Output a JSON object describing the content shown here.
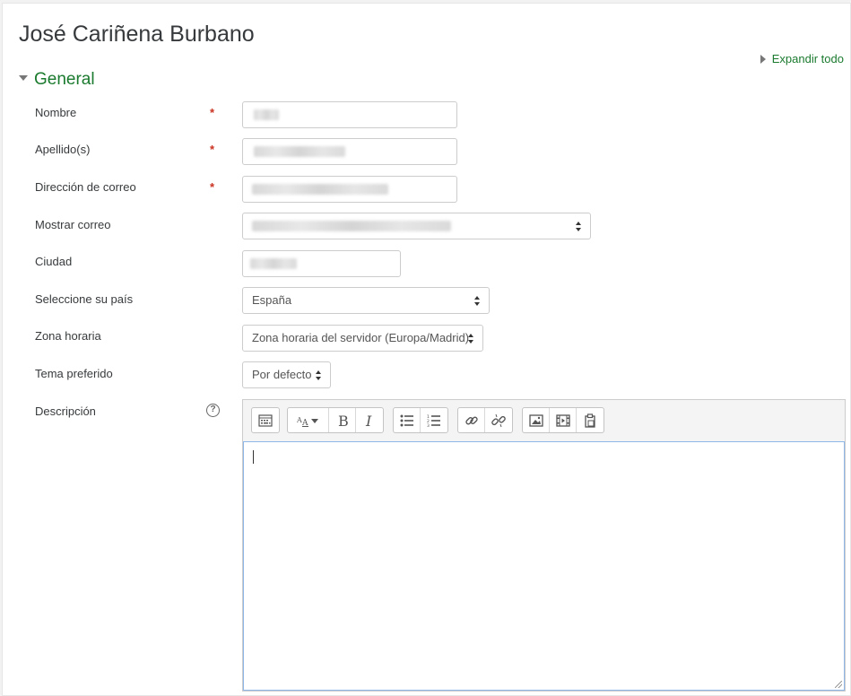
{
  "page": {
    "title": "José Cariñena Burbano"
  },
  "expand_all": "Expandir todo",
  "section": {
    "title": "General"
  },
  "fields": {
    "nombre": {
      "label": "Nombre",
      "required_mark": "*"
    },
    "apellidos": {
      "label": "Apellido(s)",
      "required_mark": "*"
    },
    "correo": {
      "label": "Dirección de correo",
      "required_mark": "*"
    },
    "mostrar_correo": {
      "label": "Mostrar correo"
    },
    "ciudad": {
      "label": "Ciudad"
    },
    "pais": {
      "label": "Seleccione su país",
      "value": "España"
    },
    "zona_horaria": {
      "label": "Zona horaria",
      "value": "Zona horaria del servidor (Europa/Madrid)"
    },
    "tema": {
      "label": "Tema preferido",
      "value": "Por defecto"
    },
    "descripcion": {
      "label": "Descripción",
      "help_glyph": "?"
    }
  },
  "editor_toolbar": [
    {
      "group": "show-more",
      "icons": [
        "toolbar-toggle-icon"
      ]
    },
    {
      "group": "style",
      "icons": [
        "paragraph-styles-icon",
        "bold-icon",
        "italic-icon"
      ]
    },
    {
      "group": "list",
      "icons": [
        "unordered-list-icon",
        "ordered-list-icon"
      ]
    },
    {
      "group": "links",
      "icons": [
        "link-icon",
        "unlink-icon"
      ]
    },
    {
      "group": "files",
      "icons": [
        "image-icon",
        "media-icon",
        "manage-files-icon"
      ]
    }
  ],
  "colors": {
    "accent_green": "#1a7a2e",
    "required_red": "#ca3120",
    "focus_border": "#8fb8e8"
  }
}
